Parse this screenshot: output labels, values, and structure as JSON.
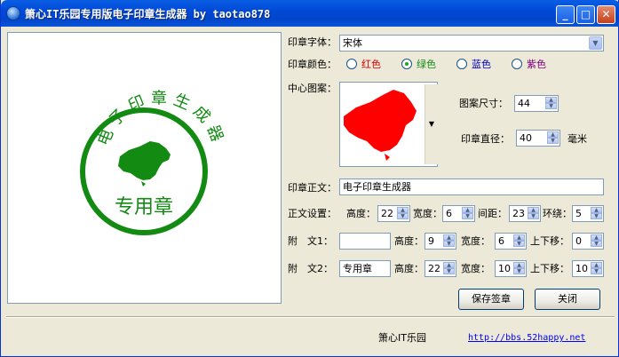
{
  "window": {
    "title": "箫心IT乐园专用版电子印章生成器 by taotao878",
    "min_glyph": "_",
    "max_glyph": "□",
    "close_glyph": "✕"
  },
  "stamp": {
    "top_text": "电子印章生成器",
    "bottom_text": "专用章",
    "color": "#138b13"
  },
  "form": {
    "font_label": "印章字体：",
    "font_value": "宋体",
    "color_label": "印章颜色：",
    "colors": [
      {
        "label": "红色",
        "hex": "#e00000",
        "selected": false
      },
      {
        "label": "绿色",
        "hex": "#138b13",
        "selected": true
      },
      {
        "label": "蓝色",
        "hex": "#0000c0",
        "selected": false
      },
      {
        "label": "紫色",
        "hex": "#800080",
        "selected": false
      }
    ],
    "pattern_label": "中心图案：",
    "pattern_size_label": "图案尺寸：",
    "pattern_size_value": "44",
    "diameter_label": "印章直径：",
    "diameter_value": "40",
    "diameter_unit": "毫米",
    "main_text_label": "印章正文：",
    "main_text_value": "电子印章生成器",
    "text_settings_label": "正文设置：",
    "height_label": "高度：",
    "height_value": "22",
    "width_label": "宽度：",
    "width_value": "6",
    "spacing_label": "间距：",
    "spacing_value": "23",
    "wrap_label": "环绕：",
    "wrap_value": "5",
    "sub1_label_a": "附",
    "sub1_label_b": "文1：",
    "sub1_value": "",
    "sub1_height_label": "高度：",
    "sub1_height_value": "9",
    "sub1_width_label": "宽度：",
    "sub1_width_value": "6",
    "sub1_shift_label": "上下移：",
    "sub1_shift_value": "0",
    "sub2_label_a": "附",
    "sub2_label_b": "文2：",
    "sub2_value": "专用章",
    "sub2_height_label": "高度：",
    "sub2_height_value": "22",
    "sub2_width_label": "宽度：",
    "sub2_width_value": "10",
    "sub2_shift_label": "上下移：",
    "sub2_shift_value": "10",
    "save_button": "保存签章",
    "close_button": "关闭"
  },
  "footer": {
    "brand": "箫心IT乐园",
    "url": "http://bbs.52happy.net"
  }
}
